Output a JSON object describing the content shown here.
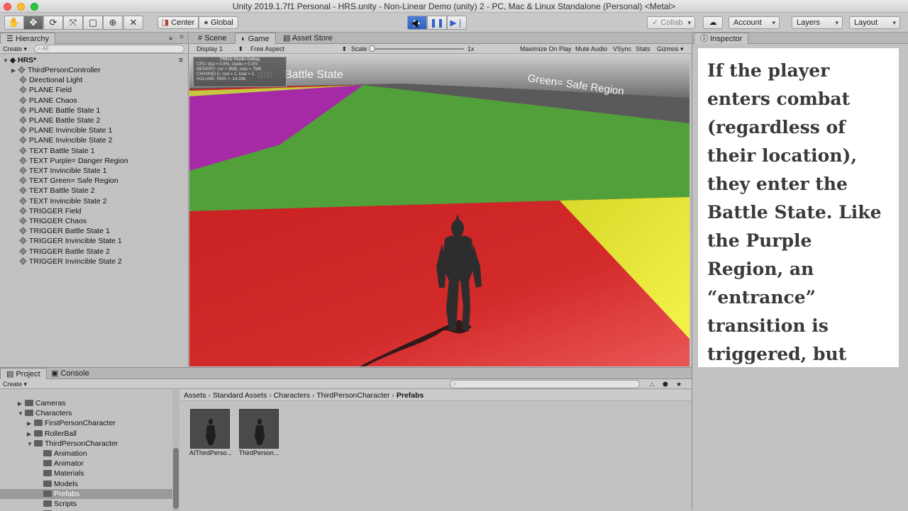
{
  "window_title": "Unity 2019.1.7f1 Personal - HRS.unity - Non-Linear Demo (unity) 2 - PC, Mac & Linux Standalone (Personal) <Metal>",
  "toolbar": {
    "tools": [
      "hand-icon",
      "move-icon",
      "rotate-icon",
      "scale-icon",
      "rect-icon",
      "transform-icon",
      "custom-icon"
    ],
    "center_label": "Center",
    "global_label": "Global",
    "play_icons": [
      "play-icon",
      "pause-icon",
      "step-icon"
    ],
    "collab_label": "Collab",
    "account_label": "Account",
    "layers_label": "Layers",
    "layout_label": "Layout"
  },
  "hierarchy": {
    "tab": "Hierarchy",
    "create": "Create",
    "search_placeholder": "All",
    "scene": "HRS*",
    "items": [
      "ThirdPersonController",
      "Directional Light",
      "PLANE Field",
      "PLANE Chaos",
      "PLANE Battle State 1",
      "PLANE Battle State 2",
      "PLANE Invincible State 1",
      "PLANE Invincible State 2",
      "TEXT Battle State 1",
      "TEXT Purple= Danger Region",
      "TEXT Invincible State 1",
      "TEXT Green= Safe Region",
      "TEXT Battle State 2",
      "TEXT Invincible State 2",
      "TRIGGER Field",
      "TRIGGER Chaos",
      "TRIGGER Battle State 1",
      "TRIGGER Invincible State 1",
      "TRIGGER Battle State 2",
      "TRIGGER Invincible State 2"
    ]
  },
  "game": {
    "tabs": [
      "Scene",
      "Game",
      "Asset Store"
    ],
    "display": "Display 1",
    "aspect": "Free Aspect",
    "scale_label": "Scale",
    "scale_value": "1x",
    "scale_fraction": 0.0,
    "options": [
      "Maximize On Play",
      "Mute Audio",
      "VSync",
      "Stats",
      "Gizmos"
    ],
    "debug_title": "FMOD Studio Debug",
    "debug_lines": [
      "CPU: dsp = 0.8%, studio = 0.3%",
      "MEMORY: cur = 8MB, max = 7MB",
      "CHANNELS: real = 1, total = 1",
      "VOLUME: RMS = -14.2db"
    ],
    "scene_text_left": "Battle State",
    "scene_text_right": "Green= Safe Region",
    "scene_text_faded": "ate"
  },
  "inspector": {
    "tab": "Inspector",
    "text": "If the player enters combat (regardless of their location), they enter the Battle State. Like the Purple Region, an “entrance” transition is triggered, but upon exiting it simply fades out."
  },
  "project": {
    "tabs": [
      "Project",
      "Console"
    ],
    "create": "Create",
    "tree": [
      {
        "label": "Cameras",
        "indent": 1,
        "arrow": "▶"
      },
      {
        "label": "Characters",
        "indent": 1,
        "arrow": "▼"
      },
      {
        "label": "FirstPersonCharacter",
        "indent": 2,
        "arrow": "▶"
      },
      {
        "label": "RollerBall",
        "indent": 2,
        "arrow": "▶"
      },
      {
        "label": "ThirdPersonCharacter",
        "indent": 2,
        "arrow": "▼"
      },
      {
        "label": "Animation",
        "indent": 3,
        "arrow": ""
      },
      {
        "label": "Animator",
        "indent": 3,
        "arrow": ""
      },
      {
        "label": "Materials",
        "indent": 3,
        "arrow": ""
      },
      {
        "label": "Models",
        "indent": 3,
        "arrow": ""
      },
      {
        "label": "Prefabs",
        "indent": 3,
        "arrow": ""
      },
      {
        "label": "Scripts",
        "indent": 3,
        "arrow": ""
      },
      {
        "label": "Textures",
        "indent": 3,
        "arrow": ""
      }
    ],
    "breadcrumb": [
      "Assets",
      "Standard Assets",
      "Characters",
      "ThirdPersonCharacter",
      "Prefabs"
    ],
    "assets": [
      "AIThirdPerso...",
      "ThirdPerson..."
    ]
  }
}
